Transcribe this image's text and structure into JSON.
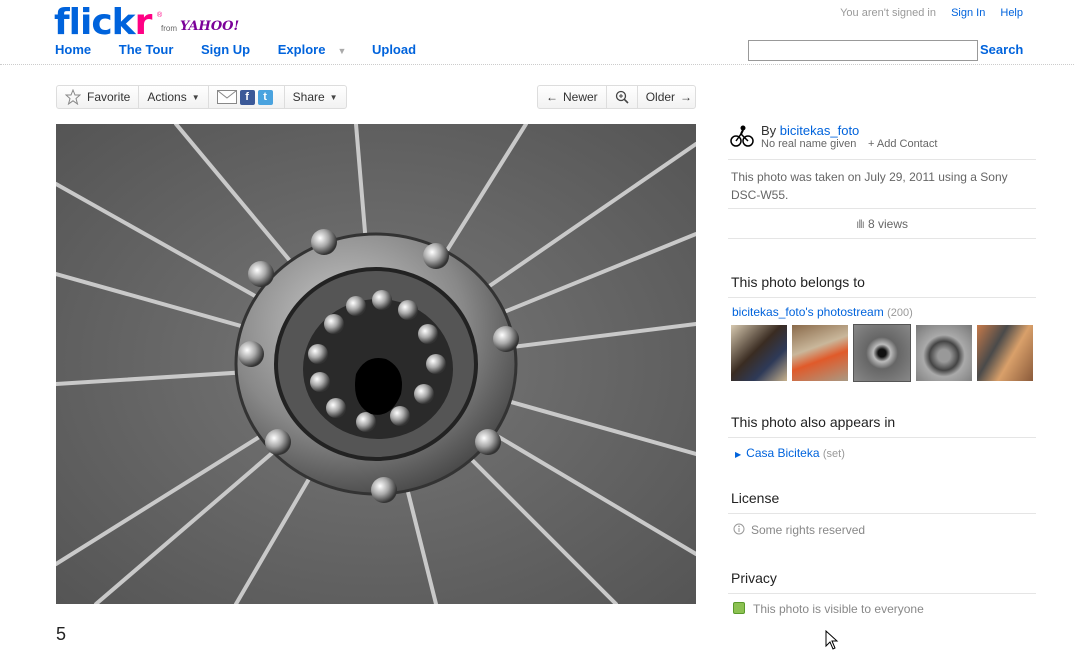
{
  "header": {
    "logo_text_main": "flick",
    "logo_text_r": "r",
    "logo_reg": "®",
    "logo_from": "from",
    "logo_yahoo": "YAHOO!",
    "not_signed_in": "You aren't signed in",
    "sign_in": "Sign In",
    "help": "Help",
    "nav": {
      "home": "Home",
      "tour": "The Tour",
      "signup": "Sign Up",
      "explore": "Explore",
      "upload": "Upload"
    },
    "search_value": "",
    "search_button": "Search"
  },
  "toolbar": {
    "favorite": "Favorite",
    "actions": "Actions",
    "share": "Share",
    "newer": "Newer",
    "older": "Older"
  },
  "photo": {
    "title": "5"
  },
  "sidebar": {
    "by_label": "By",
    "owner": "bicitekas_foto",
    "real_name": "No real name given",
    "add_contact": "+ Add Contact",
    "taken": "This photo was taken on July 29, 2011 using a Sony DSC-W55.",
    "views": "8 views",
    "belongs_heading": "This photo belongs to",
    "photostream": "bicitekas_foto's photostream",
    "photostream_count": "(200)",
    "appears_heading": "This photo also appears in",
    "set_name": "Casa Biciteka",
    "set_tag": "(set)",
    "license_heading": "License",
    "license_text": "Some rights reserved",
    "privacy_heading": "Privacy",
    "privacy_text": "This photo is visible to everyone"
  },
  "colors": {
    "flickr_blue": "#0063dc",
    "flickr_pink": "#ff0084",
    "privacy_green": "#8cc152"
  }
}
